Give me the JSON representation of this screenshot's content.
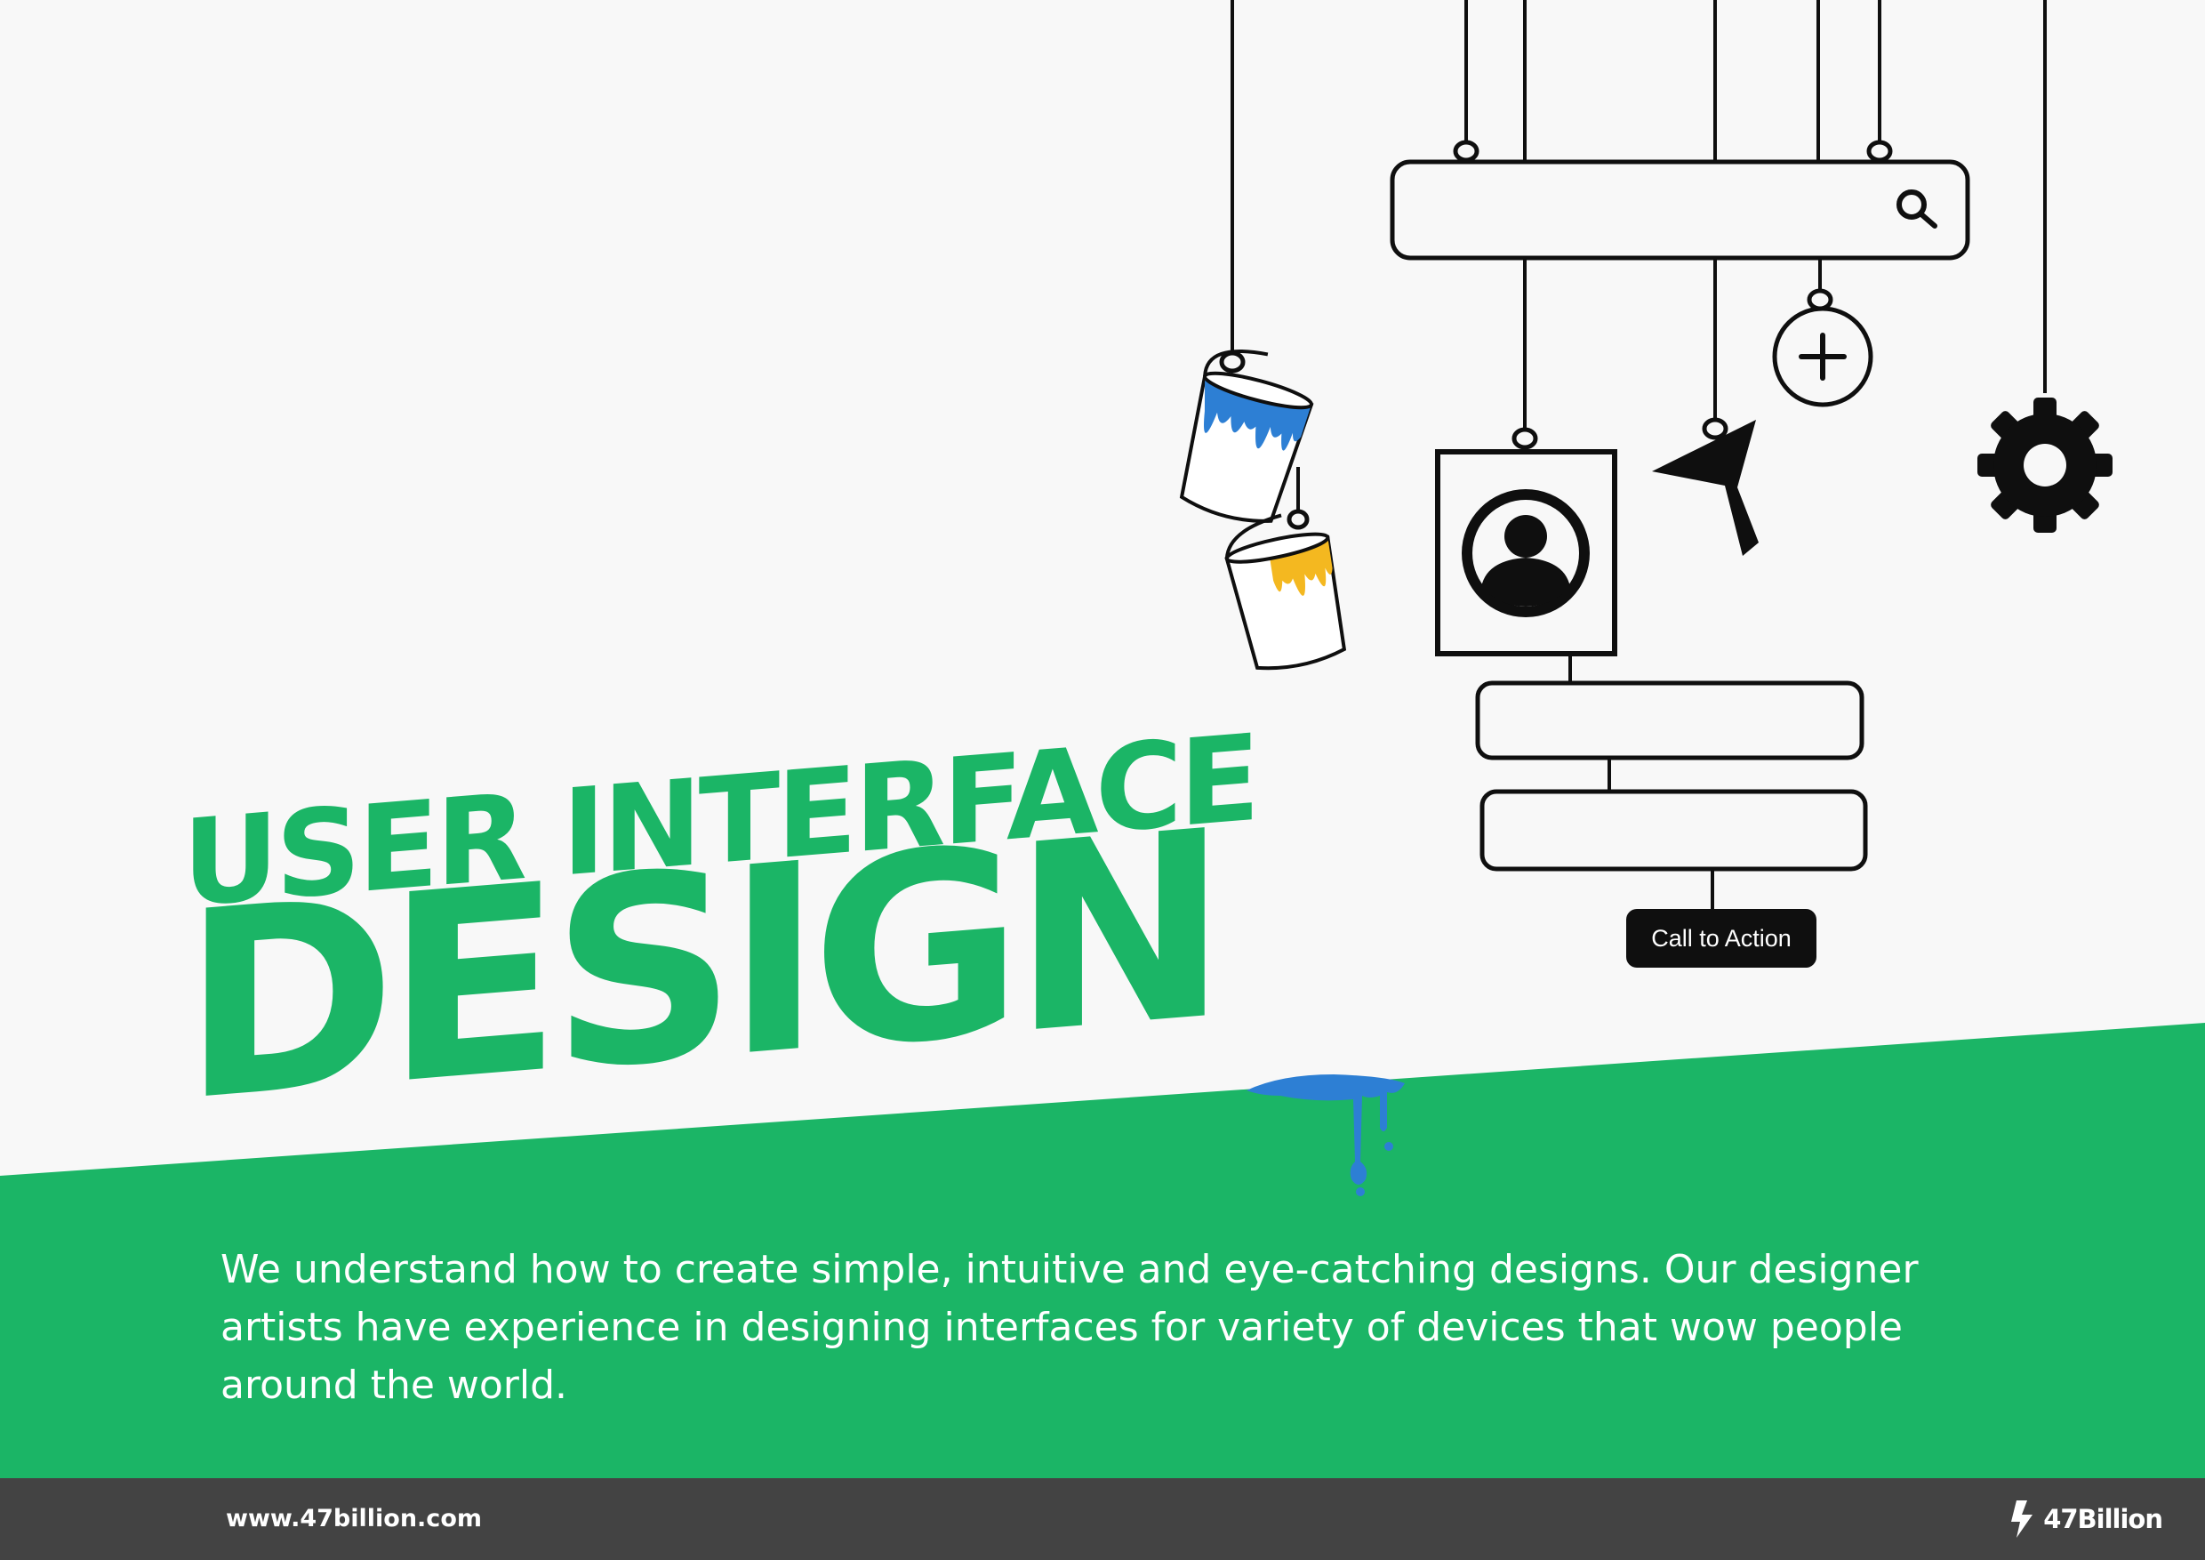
{
  "headline": {
    "line1": "USER INTERFACE",
    "line2": "DESIGN"
  },
  "description": "We understand how to create simple, intuitive and eye-catching designs. Our designer artists have experience in designing interfaces for variety of devices that wow people around the world.",
  "illustration": {
    "cta_label": "Call to Action",
    "icons": [
      "paint-bucket-icon",
      "search-icon",
      "plus-icon",
      "cursor-icon",
      "user-avatar-icon",
      "gear-icon",
      "paint-drip-icon"
    ]
  },
  "footer": {
    "website": "www.47billion.com",
    "brand": "47Billion"
  },
  "colors": {
    "brand_green": "#1bb566",
    "background": "#f8f8f8",
    "footer_bg": "#434343",
    "paint_blue": "#2d7fd4",
    "paint_yellow": "#f4b820",
    "ink": "#0f0f0f"
  }
}
